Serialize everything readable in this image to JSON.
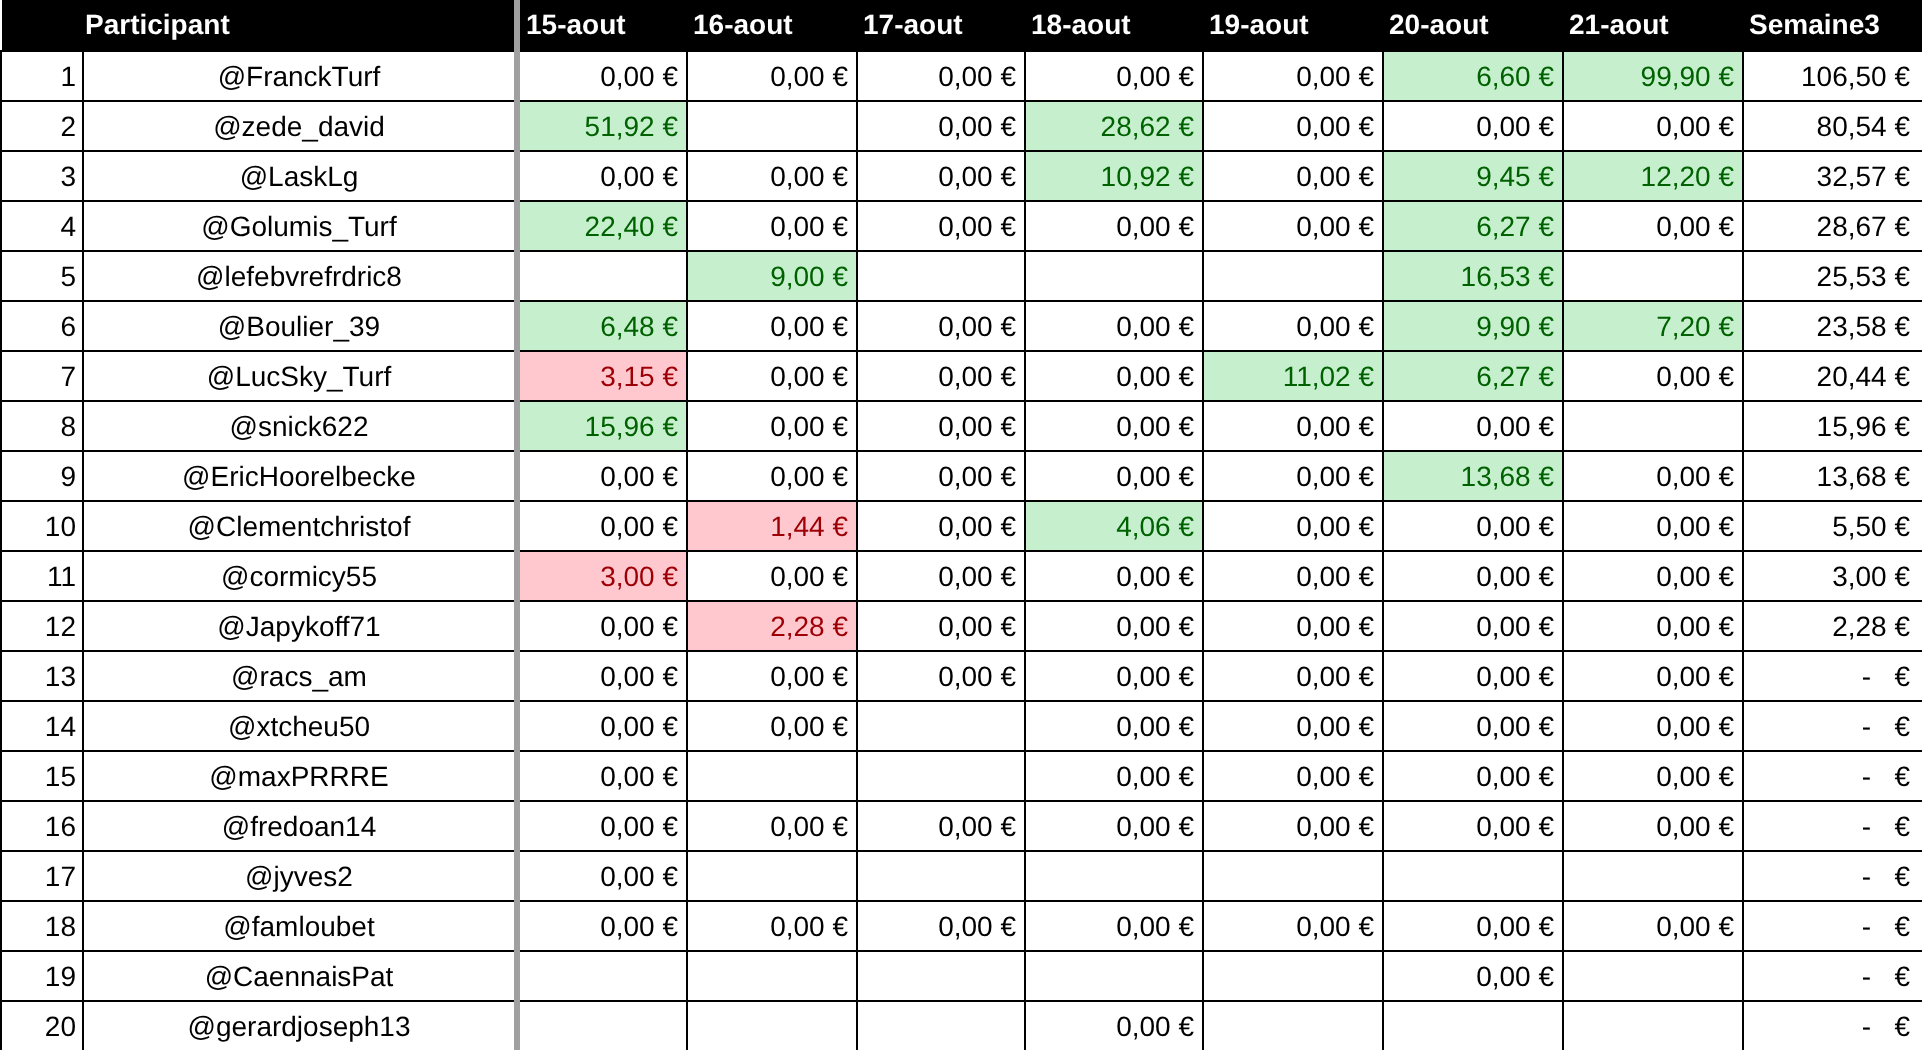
{
  "table": {
    "columns": [
      "Participant",
      "15-aout",
      "16-aout",
      "17-aout",
      "18-aout",
      "19-aout",
      "20-aout",
      "21-aout",
      "Semaine3"
    ],
    "rows": [
      {
        "rank": "1",
        "participant": "@FranckTurf",
        "days": [
          {
            "kind": "amount",
            "value": "0,00 €"
          },
          {
            "kind": "amount",
            "value": "0,00 €"
          },
          {
            "kind": "amount",
            "value": "0,00 €"
          },
          {
            "kind": "amount",
            "value": "0,00 €"
          },
          {
            "kind": "amount",
            "value": "0,00 €"
          },
          {
            "kind": "amount",
            "value": "6,60 €",
            "color": "#c6efce"
          },
          {
            "kind": "amount",
            "value": "99,90 €",
            "color": "#c6efce"
          }
        ],
        "total": "106,50 €"
      },
      {
        "rank": "2",
        "participant": "@zede_david",
        "days": [
          {
            "kind": "amount",
            "value": "51,92 €",
            "color": "#c6efce"
          },
          {
            "kind": "empty"
          },
          {
            "kind": "amount",
            "value": "0,00 €"
          },
          {
            "kind": "amount",
            "value": "28,62 €",
            "color": "#c6efce"
          },
          {
            "kind": "amount",
            "value": "0,00 €"
          },
          {
            "kind": "amount",
            "value": "0,00 €"
          },
          {
            "kind": "amount",
            "value": "0,00 €"
          }
        ],
        "total": "80,54 €"
      },
      {
        "rank": "3",
        "participant": "@LaskLg",
        "days": [
          {
            "kind": "amount",
            "value": "0,00 €"
          },
          {
            "kind": "amount",
            "value": "0,00 €"
          },
          {
            "kind": "amount",
            "value": "0,00 €"
          },
          {
            "kind": "amount",
            "value": "10,92 €",
            "color": "#c6efce"
          },
          {
            "kind": "amount",
            "value": "0,00 €"
          },
          {
            "kind": "amount",
            "value": "9,45 €",
            "color": "#c6efce"
          },
          {
            "kind": "amount",
            "value": "12,20 €",
            "color": "#c6efce"
          }
        ],
        "total": "32,57 €"
      },
      {
        "rank": "4",
        "participant": "@Golumis_Turf",
        "days": [
          {
            "kind": "amount",
            "value": "22,40 €",
            "color": "#c6efce"
          },
          {
            "kind": "amount",
            "value": "0,00 €"
          },
          {
            "kind": "amount",
            "value": "0,00 €"
          },
          {
            "kind": "amount",
            "value": "0,00 €"
          },
          {
            "kind": "amount",
            "value": "0,00 €"
          },
          {
            "kind": "amount",
            "value": "6,27 €",
            "color": "#c6efce"
          },
          {
            "kind": "amount",
            "value": "0,00 €"
          }
        ],
        "total": "28,67 €"
      },
      {
        "rank": "5",
        "participant": "@lefebvrefrdric8",
        "days": [
          {
            "kind": "empty"
          },
          {
            "kind": "amount",
            "value": "9,00 €",
            "color": "#c6efce"
          },
          {
            "kind": "empty"
          },
          {
            "kind": "empty"
          },
          {
            "kind": "empty"
          },
          {
            "kind": "amount",
            "value": "16,53 €",
            "color": "#c6efce"
          },
          {
            "kind": "empty"
          }
        ],
        "total": "25,53 €"
      },
      {
        "rank": "6",
        "participant": "@Boulier_39",
        "days": [
          {
            "kind": "amount",
            "value": "6,48 €",
            "color": "#c6efce"
          },
          {
            "kind": "amount",
            "value": "0,00 €"
          },
          {
            "kind": "amount",
            "value": "0,00 €"
          },
          {
            "kind": "amount",
            "value": "0,00 €"
          },
          {
            "kind": "amount",
            "value": "0,00 €"
          },
          {
            "kind": "amount",
            "value": "9,90 €",
            "color": "#c6efce"
          },
          {
            "kind": "amount",
            "value": "7,20 €",
            "color": "#c6efce"
          }
        ],
        "total": "23,58 €"
      },
      {
        "rank": "7",
        "participant": "@LucSky_Turf",
        "days": [
          {
            "kind": "amount",
            "value": "3,15 €",
            "color": "#ffc7ce"
          },
          {
            "kind": "amount",
            "value": "0,00 €"
          },
          {
            "kind": "amount",
            "value": "0,00 €"
          },
          {
            "kind": "amount",
            "value": "0,00 €"
          },
          {
            "kind": "amount",
            "value": "11,02 €",
            "color": "#c6efce"
          },
          {
            "kind": "amount",
            "value": "6,27 €",
            "color": "#c6efce"
          },
          {
            "kind": "amount",
            "value": "0,00 €"
          }
        ],
        "total": "20,44 €"
      },
      {
        "rank": "8",
        "participant": "@snick622",
        "days": [
          {
            "kind": "amount",
            "value": "15,96 €",
            "color": "#c6efce"
          },
          {
            "kind": "amount",
            "value": "0,00 €"
          },
          {
            "kind": "amount",
            "value": "0,00 €"
          },
          {
            "kind": "amount",
            "value": "0,00 €"
          },
          {
            "kind": "amount",
            "value": "0,00 €"
          },
          {
            "kind": "amount",
            "value": "0,00 €"
          },
          {
            "kind": "empty"
          }
        ],
        "total": "15,96 €"
      },
      {
        "rank": "9",
        "participant": "@EricHoorelbecke",
        "days": [
          {
            "kind": "amount",
            "value": "0,00 €"
          },
          {
            "kind": "amount",
            "value": "0,00 €"
          },
          {
            "kind": "amount",
            "value": "0,00 €"
          },
          {
            "kind": "amount",
            "value": "0,00 €"
          },
          {
            "kind": "amount",
            "value": "0,00 €"
          },
          {
            "kind": "amount",
            "value": "13,68 €",
            "color": "#c6efce"
          },
          {
            "kind": "amount",
            "value": "0,00 €"
          }
        ],
        "total": "13,68 €"
      },
      {
        "rank": "10",
        "participant": "@Clementchristof",
        "days": [
          {
            "kind": "amount",
            "value": "0,00 €"
          },
          {
            "kind": "amount",
            "value": "1,44 €",
            "color": "#ffc7ce"
          },
          {
            "kind": "amount",
            "value": "0,00 €"
          },
          {
            "kind": "amount",
            "value": "4,06 €",
            "color": "#c6efce"
          },
          {
            "kind": "amount",
            "value": "0,00 €"
          },
          {
            "kind": "amount",
            "value": "0,00 €"
          },
          {
            "kind": "amount",
            "value": "0,00 €"
          }
        ],
        "total": "5,50 €"
      },
      {
        "rank": "11",
        "participant": "@cormicy55",
        "days": [
          {
            "kind": "amount",
            "value": "3,00 €",
            "color": "#ffc7ce"
          },
          {
            "kind": "amount",
            "value": "0,00 €"
          },
          {
            "kind": "amount",
            "value": "0,00 €"
          },
          {
            "kind": "amount",
            "value": "0,00 €"
          },
          {
            "kind": "amount",
            "value": "0,00 €"
          },
          {
            "kind": "amount",
            "value": "0,00 €"
          },
          {
            "kind": "amount",
            "value": "0,00 €"
          }
        ],
        "total": "3,00 €"
      },
      {
        "rank": "12",
        "participant": "@Japykoff71",
        "days": [
          {
            "kind": "amount",
            "value": "0,00 €"
          },
          {
            "kind": "amount",
            "value": "2,28 €",
            "color": "#ffc7ce"
          },
          {
            "kind": "amount",
            "value": "0,00 €"
          },
          {
            "kind": "amount",
            "value": "0,00 €"
          },
          {
            "kind": "amount",
            "value": "0,00 €"
          },
          {
            "kind": "amount",
            "value": "0,00 €"
          },
          {
            "kind": "amount",
            "value": "0,00 €"
          }
        ],
        "total": "2,28 €"
      },
      {
        "rank": "13",
        "participant": "@racs_am",
        "days": [
          {
            "kind": "amount",
            "value": "0,00 €"
          },
          {
            "kind": "amount",
            "value": "0,00 €"
          },
          {
            "kind": "amount",
            "value": "0,00 €"
          },
          {
            "kind": "amount",
            "value": "0,00 €"
          },
          {
            "kind": "amount",
            "value": "0,00 €"
          },
          {
            "kind": "amount",
            "value": "0,00 €"
          },
          {
            "kind": "amount",
            "value": "0,00 €"
          }
        ],
        "total": "-   €"
      },
      {
        "rank": "14",
        "participant": "@xtcheu50",
        "days": [
          {
            "kind": "amount",
            "value": "0,00 €"
          },
          {
            "kind": "amount",
            "value": "0,00 €"
          },
          {
            "kind": "empty"
          },
          {
            "kind": "amount",
            "value": "0,00 €"
          },
          {
            "kind": "amount",
            "value": "0,00 €"
          },
          {
            "kind": "amount",
            "value": "0,00 €"
          },
          {
            "kind": "amount",
            "value": "0,00 €"
          }
        ],
        "total": "-   €"
      },
      {
        "rank": "15",
        "participant": "@maxPRRRE",
        "days": [
          {
            "kind": "amount",
            "value": "0,00 €"
          },
          {
            "kind": "empty"
          },
          {
            "kind": "empty"
          },
          {
            "kind": "amount",
            "value": "0,00 €"
          },
          {
            "kind": "amount",
            "value": "0,00 €"
          },
          {
            "kind": "amount",
            "value": "0,00 €"
          },
          {
            "kind": "amount",
            "value": "0,00 €"
          }
        ],
        "total": "-   €"
      },
      {
        "rank": "16",
        "participant": "@fredoan14",
        "days": [
          {
            "kind": "amount",
            "value": "0,00 €"
          },
          {
            "kind": "amount",
            "value": "0,00 €"
          },
          {
            "kind": "amount",
            "value": "0,00 €"
          },
          {
            "kind": "amount",
            "value": "0,00 €"
          },
          {
            "kind": "amount",
            "value": "0,00 €"
          },
          {
            "kind": "amount",
            "value": "0,00 €"
          },
          {
            "kind": "amount",
            "value": "0,00 €"
          }
        ],
        "total": "-   €"
      },
      {
        "rank": "17",
        "participant": "@jyves2",
        "days": [
          {
            "kind": "amount",
            "value": "0,00 €"
          },
          {
            "kind": "empty"
          },
          {
            "kind": "empty"
          },
          {
            "kind": "empty"
          },
          {
            "kind": "empty"
          },
          {
            "kind": "empty"
          },
          {
            "kind": "empty"
          }
        ],
        "total": "-   €"
      },
      {
        "rank": "18",
        "participant": "@famloubet",
        "days": [
          {
            "kind": "amount",
            "value": "0,00 €"
          },
          {
            "kind": "amount",
            "value": "0,00 €"
          },
          {
            "kind": "amount",
            "value": "0,00 €"
          },
          {
            "kind": "amount",
            "value": "0,00 €"
          },
          {
            "kind": "amount",
            "value": "0,00 €"
          },
          {
            "kind": "amount",
            "value": "0,00 €"
          },
          {
            "kind": "amount",
            "value": "0,00 €"
          }
        ],
        "total": "-   €"
      },
      {
        "rank": "19",
        "participant": "@CaennaisPat",
        "days": [
          {
            "kind": "empty"
          },
          {
            "kind": "empty"
          },
          {
            "kind": "empty"
          },
          {
            "kind": "empty"
          },
          {
            "kind": "empty"
          },
          {
            "kind": "amount",
            "value": "0,00 €"
          },
          {
            "kind": "empty"
          }
        ],
        "total": "-   €"
      },
      {
        "rank": "20",
        "participant": "@gerardjoseph13",
        "days": [
          {
            "kind": "empty"
          },
          {
            "kind": "empty"
          },
          {
            "kind": "empty"
          },
          {
            "kind": "amount",
            "value": "0,00 €"
          },
          {
            "kind": "empty"
          },
          {
            "kind": "empty"
          },
          {
            "kind": "empty"
          }
        ],
        "total": "-   €"
      }
    ]
  }
}
